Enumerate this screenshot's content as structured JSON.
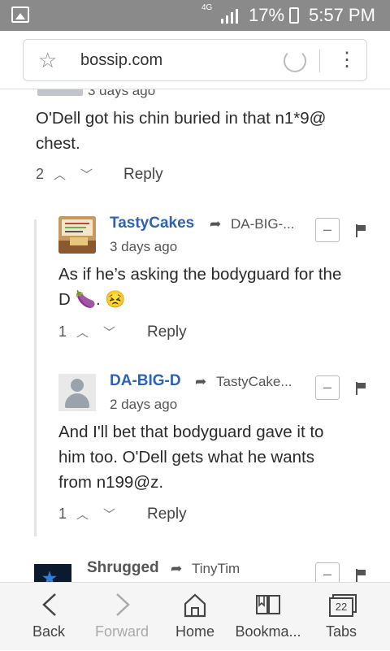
{
  "status_bar": {
    "signal_label": "4G",
    "battery": "17%",
    "time": "5:57 PM"
  },
  "browser": {
    "url": "bossip.com"
  },
  "comments": {
    "top_partial": {
      "time": "3 days ago",
      "text": "O'Dell got his chin buried in that n1*9@ chest.",
      "votes": "2",
      "reply": "Reply"
    },
    "c1": {
      "author": "TastyCakes",
      "reply_to": "DA-BIG-...",
      "time": "3 days ago",
      "text_line1": "As if he’s asking the bodyguard for the",
      "text_line2": "D 🍆. 😣",
      "votes": "1",
      "reply": "Reply",
      "collapse": "–"
    },
    "c2": {
      "author": "DA-BIG-D",
      "reply_to": "TastyCake...",
      "time": "2 days ago",
      "text_line1": "And I'll bet that bodyguard gave it to",
      "text_line2": "him too. O'Dell gets what he wants",
      "text_line3": "from n199@z.",
      "votes": "1",
      "reply": "Reply",
      "collapse": "–"
    },
    "c3": {
      "author": "Shrugged",
      "reply_to": "TinyTim",
      "collapse": "–"
    }
  },
  "bottom_nav": {
    "back": "Back",
    "forward": "Forward",
    "home": "Home",
    "bookmarks": "Bookma...",
    "tabs": "Tabs",
    "tab_count": "22"
  }
}
